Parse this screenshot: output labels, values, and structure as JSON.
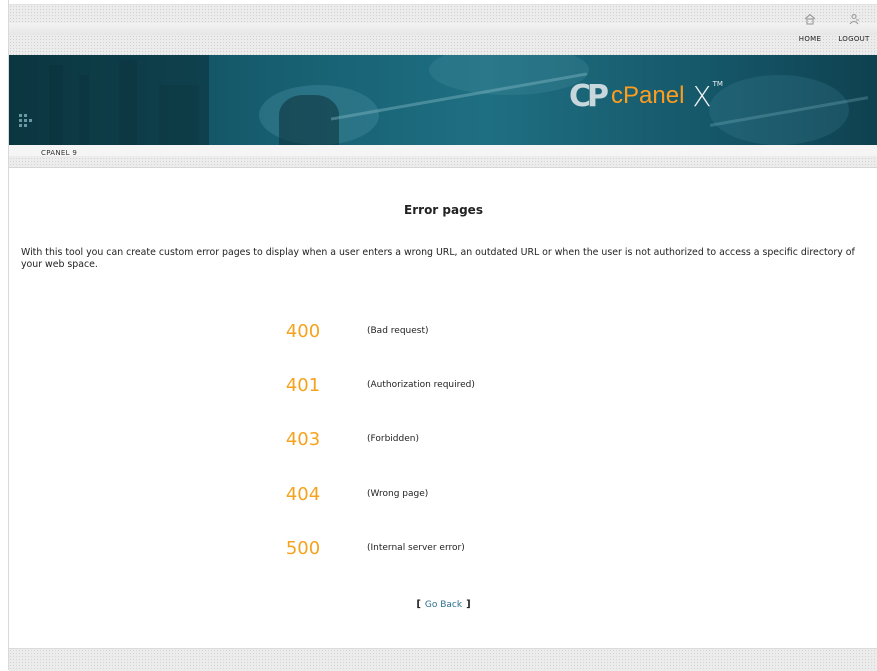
{
  "header": {
    "links": [
      {
        "label": "HOME",
        "icon": "home-icon"
      },
      {
        "label": "LOGOUT",
        "icon": "logout-icon"
      }
    ]
  },
  "logo": {
    "mark": "CP",
    "name": "cPanel",
    "x": "X",
    "tm": "TM"
  },
  "breadcrumb": "CPANEL 9",
  "page": {
    "title": "Error pages",
    "intro": "With this tool you can create custom error pages to display when a user enters a wrong URL, an outdated URL or when the user is not authorized to access a specific directory of your web space."
  },
  "errors": [
    {
      "code": "400",
      "description": "(Bad request)"
    },
    {
      "code": "401",
      "description": "(Authorization required)"
    },
    {
      "code": "403",
      "description": "(Forbidden)"
    },
    {
      "code": "404",
      "description": "(Wrong page)"
    },
    {
      "code": "500",
      "description": "(Internal server error)"
    }
  ],
  "goback": {
    "open": "[",
    "label": "Go Back",
    "close": "]"
  },
  "colors": {
    "accent_orange": "#f5a31e",
    "banner_teal": "#165e70",
    "link_blue": "#2c6e8f"
  }
}
